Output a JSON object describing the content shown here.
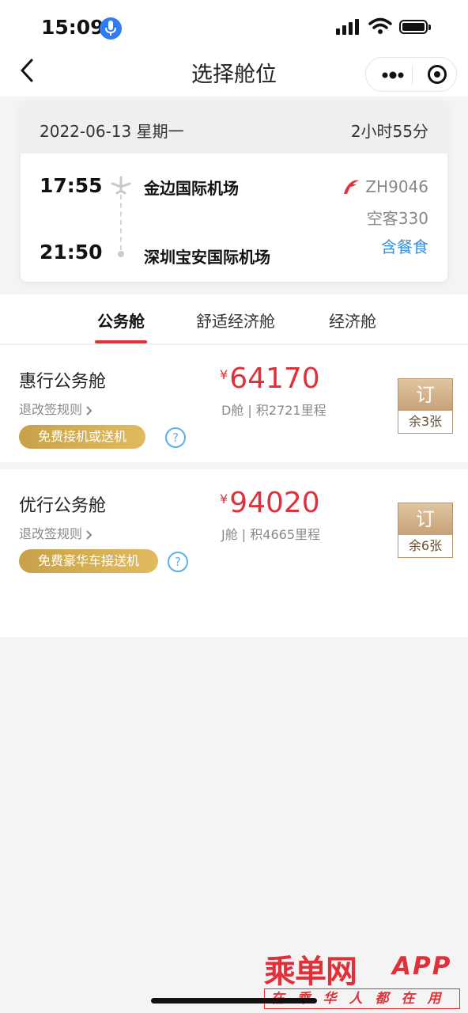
{
  "status_bar": {
    "time": "15:09"
  },
  "nav": {
    "title": "选择舱位"
  },
  "flight": {
    "date": "2022-06-13 星期一",
    "duration": "2小时55分",
    "dep_time": "17:55",
    "dep_airport": "金边国际机场",
    "arr_time": "21:50",
    "arr_airport": "深圳宝安国际机场",
    "flight_no": "ZH9046",
    "aircraft": "空客330",
    "meal": "含餐食",
    "airline_color": "#e0303a"
  },
  "tabs": [
    {
      "label": "公务舱",
      "active": true
    },
    {
      "label": "舒适经济舱",
      "active": false
    },
    {
      "label": "经济舱",
      "active": false
    }
  ],
  "cabins": [
    {
      "name": "惠行公务舱",
      "rules": "退改签规则",
      "perk": "免费接机或送机",
      "currency": "¥",
      "price": "64170",
      "class_info": "D舱 | 积2721里程",
      "book": "订",
      "remain": "余3张"
    },
    {
      "name": "优行公务舱",
      "rules": "退改签规则",
      "perk": "免费豪华车接送机",
      "currency": "¥",
      "price": "94020",
      "class_info": "J舱 | 积4665里程",
      "book": "订",
      "remain": "余6张"
    }
  ],
  "help_mark": "?",
  "watermark": {
    "brand": "乘单网",
    "app": "APP",
    "tagline": "在乘华人都在用"
  },
  "colors": {
    "accent": "#e0303a",
    "gold": "#c8a24a",
    "link": "#3a8fd6"
  }
}
